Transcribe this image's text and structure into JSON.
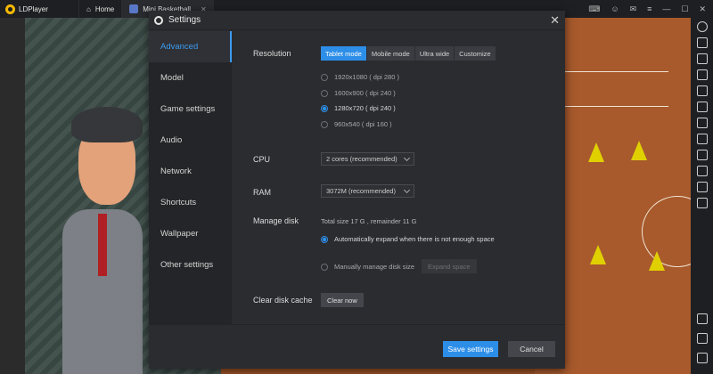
{
  "app": {
    "name": "LDPlayer"
  },
  "tabs": [
    {
      "label": "Home"
    },
    {
      "label": "Mini Basketball"
    }
  ],
  "dialog": {
    "title": "Settings",
    "close_glyph": "✕",
    "nav": [
      "Advanced",
      "Model",
      "Game settings",
      "Audio",
      "Network",
      "Shortcuts",
      "Wallpaper",
      "Other settings"
    ],
    "active_nav": "Advanced",
    "resolution": {
      "label": "Resolution",
      "modes": [
        "Tablet mode",
        "Mobile mode",
        "Ultra wide",
        "Customize"
      ],
      "active_mode": "Tablet mode",
      "options": [
        "1920x1080 ( dpi 280 )",
        "1600x900 ( dpi 240 )",
        "1280x720 ( dpi 240 )",
        "960x540 ( dpi 160 )"
      ],
      "selected": "1280x720 ( dpi 240 )"
    },
    "cpu": {
      "label": "CPU",
      "value": "2 cores (recommended)"
    },
    "ram": {
      "label": "RAM",
      "value": "3072M (recommended)"
    },
    "disk": {
      "label": "Manage disk",
      "info": "Total size 17 G , remainder 11 G",
      "option_auto": "Automatically expand when there is not enough space",
      "option_manual": "Manually manage disk size",
      "expand_button": "Expand space",
      "selected": "auto"
    },
    "clear_cache": {
      "label": "Clear disk cache",
      "button": "Clear now"
    },
    "save_button": "Save settings",
    "cancel_button": "Cancel"
  },
  "colors": {
    "accent": "#2d8ee8",
    "dialog_bg": "#2b2c30",
    "nav_bg": "#242528"
  }
}
